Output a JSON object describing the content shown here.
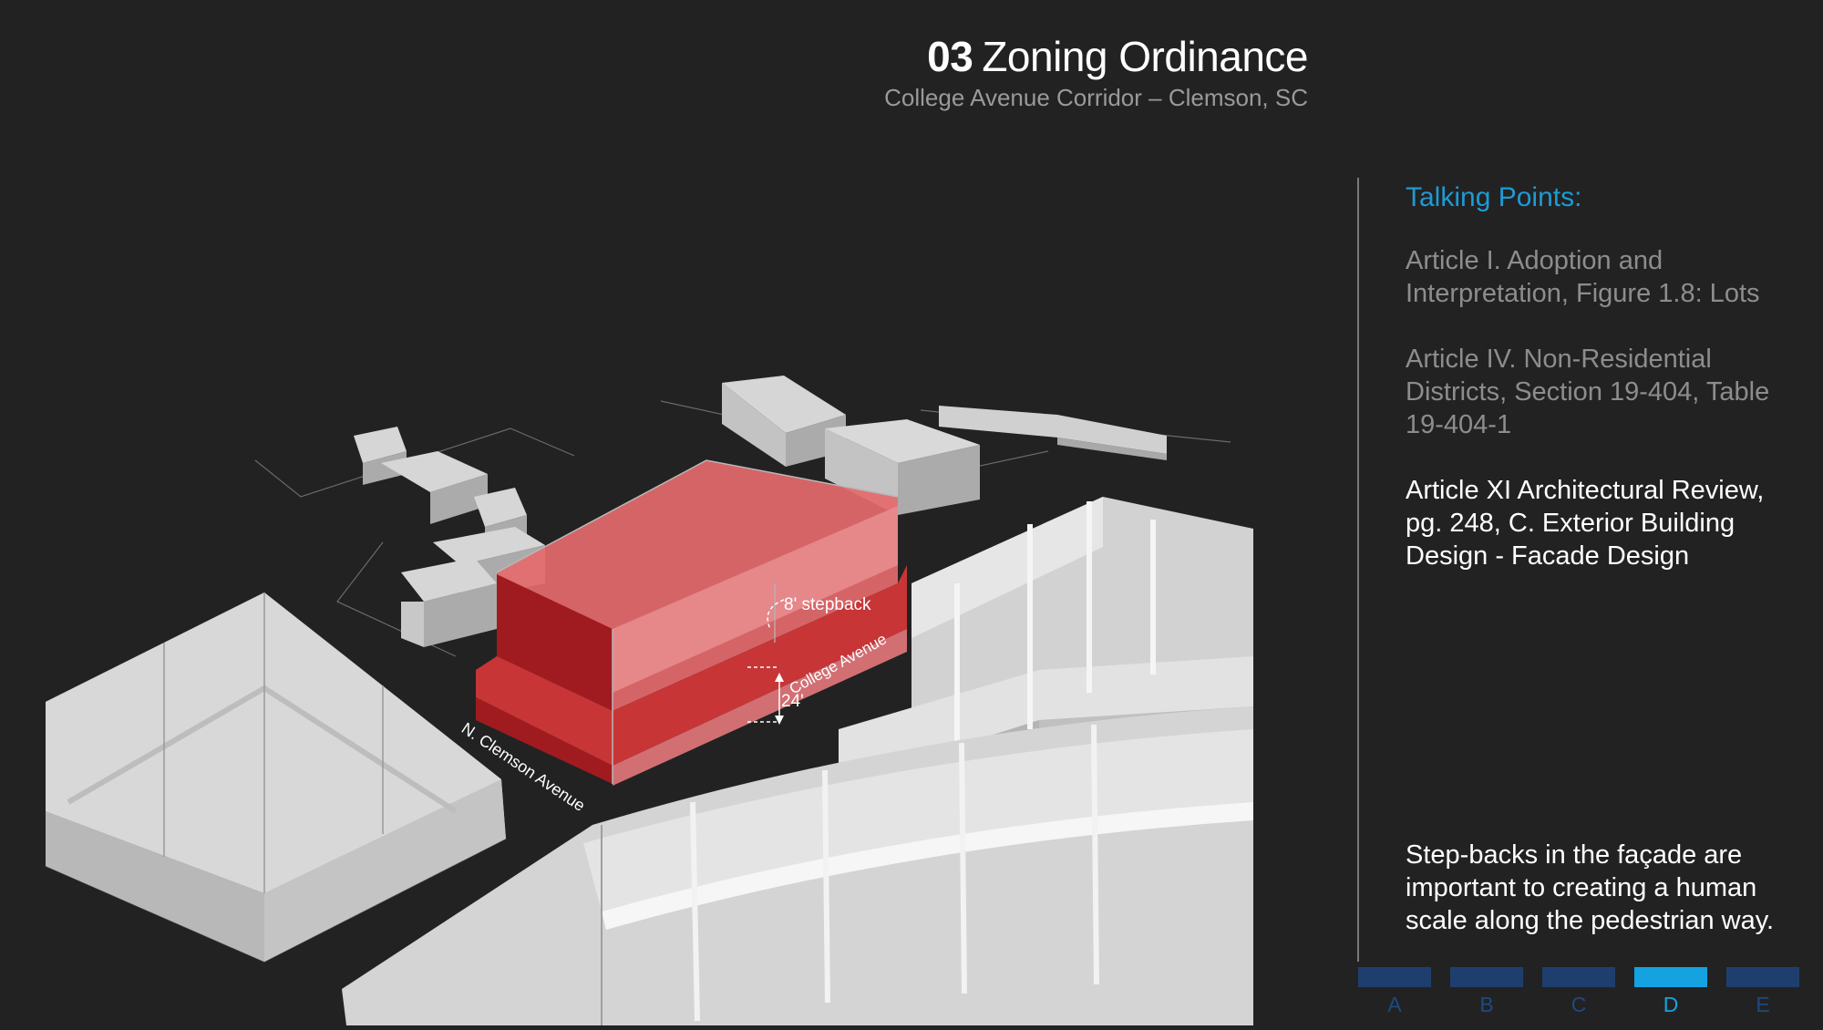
{
  "header": {
    "number": "03",
    "title": "Zoning Ordinance",
    "subtitle": "College Avenue Corridor – Clemson, SC"
  },
  "diagram": {
    "labels": {
      "stepback": "8' stepback",
      "height": "24'",
      "street_1": "College Avenue",
      "street_2": "N. Clemson Avenue"
    },
    "colors": {
      "proposed_building": "#d9373a",
      "context_building": "#d8d8d8",
      "background": "#222223"
    }
  },
  "sidebar": {
    "heading": "Talking Points:",
    "points": [
      "Article I. Adoption and Interpretation, Figure 1.8: Lots",
      "Article IV. Non-Residential Districts, Section 19-404, Table 19-404-1",
      "Article XI Architectural Review, pg. 248, C. Exterior Building Design - Facade Design"
    ],
    "note": "Step-backs in the façade are important to creating a human scale along the pedestrian way."
  },
  "nav": {
    "items": [
      "A",
      "B",
      "C",
      "D",
      "E"
    ],
    "active": "D"
  }
}
